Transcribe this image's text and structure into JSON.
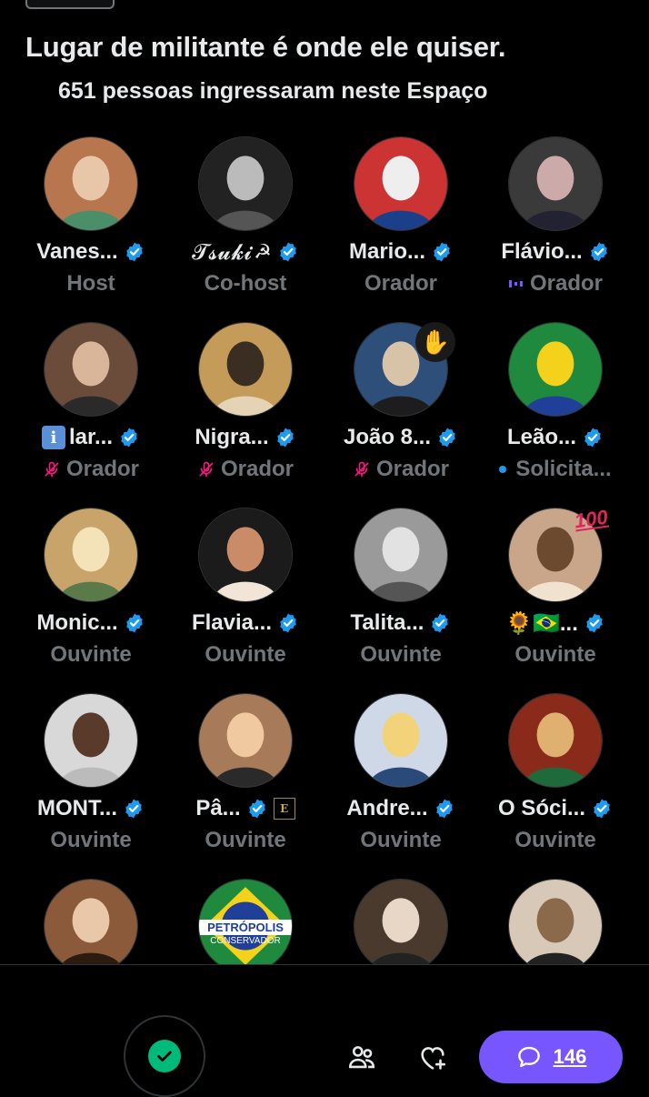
{
  "space": {
    "title": "Lugar de militante é onde ele quiser.",
    "joined": "651 pessoas ingressaram neste Espaço"
  },
  "participants": [
    {
      "name": "Vanes...",
      "role": "Host",
      "verified": true
    },
    {
      "name": "𝓣𝓼𝓾𝓴𝓲",
      "role": "Co-host",
      "verified": true,
      "extra": "☭"
    },
    {
      "name": "Mario...",
      "role": "Orador",
      "verified": true
    },
    {
      "name": "Flávio...",
      "role": "Orador",
      "verified": true,
      "role_icon": "speaking-indicator"
    },
    {
      "name": "lar...",
      "role": "Orador",
      "verified": true,
      "prefix": "i",
      "role_icon": "mic-off"
    },
    {
      "name": "Nigra...",
      "role": "Orador",
      "verified": true,
      "role_icon": "mic-off"
    },
    {
      "name": "João 8...",
      "role": "Orador",
      "verified": true,
      "role_icon": "mic-off",
      "badge": "✋"
    },
    {
      "name": "Leão...",
      "role": "Solicita...",
      "verified": true,
      "role_icon": "request-dot"
    },
    {
      "name": "Monic...",
      "role": "Ouvinte",
      "verified": true
    },
    {
      "name": "Flavia...",
      "role": "Ouvinte",
      "verified": true
    },
    {
      "name": "Talita...",
      "role": "Ouvinte",
      "verified": true
    },
    {
      "name": "🌻🇧🇷...",
      "role": "Ouvinte",
      "verified": true,
      "badge100": "100"
    },
    {
      "name": "MONT...",
      "role": "Ouvinte",
      "verified": true
    },
    {
      "name": "Pâ...",
      "role": "Ouvinte",
      "verified": true,
      "sub_badge": "E"
    },
    {
      "name": "Andre...",
      "role": "Ouvinte",
      "verified": true
    },
    {
      "name": "O Sóci...",
      "role": "Ouvinte",
      "verified": true
    },
    {
      "name": "",
      "role": "",
      "verified": false
    },
    {
      "name": "",
      "role": "",
      "verified": false,
      "logo_text": "PETRÓPOLIS",
      "logo_sub": "CONSERVADOR"
    },
    {
      "name": "",
      "role": "",
      "verified": false
    },
    {
      "name": "",
      "role": "",
      "verified": false
    }
  ],
  "footer": {
    "comment_count": "146"
  },
  "colors": {
    "accent": "#7856ff",
    "verified": "#1d9bf0",
    "mic_on": "#00ba7c",
    "mic_off": "#f91880",
    "muted_text": "#71767b"
  }
}
